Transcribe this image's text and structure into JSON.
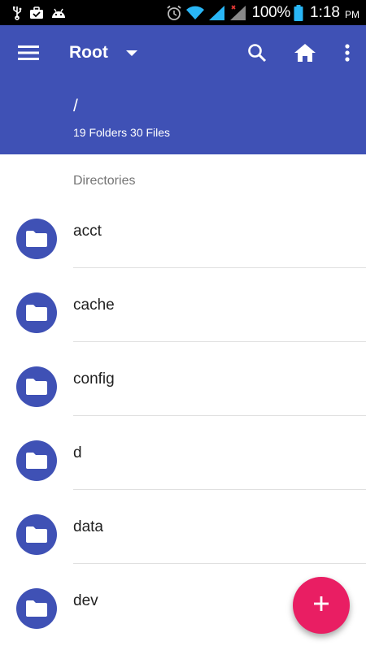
{
  "status_bar": {
    "battery_percent": "100%",
    "time": "1:18",
    "ampm": "PM",
    "left_icons": [
      "usb-icon",
      "briefcase-icon",
      "android-icon"
    ],
    "right_icons": [
      "alarm-icon",
      "wifi-icon",
      "signal-icon",
      "signal-no-data-icon",
      "battery-icon"
    ]
  },
  "app_bar": {
    "title": "Root",
    "path": "/",
    "summary": "19 Folders 30 Files",
    "color": "#3f51b5"
  },
  "content": {
    "section_header": "Directories",
    "items": [
      {
        "label": "acct"
      },
      {
        "label": "cache"
      },
      {
        "label": "config"
      },
      {
        "label": "d"
      },
      {
        "label": "data"
      },
      {
        "label": "dev"
      }
    ]
  },
  "fab": {
    "label": "+",
    "color": "#e91e63"
  }
}
